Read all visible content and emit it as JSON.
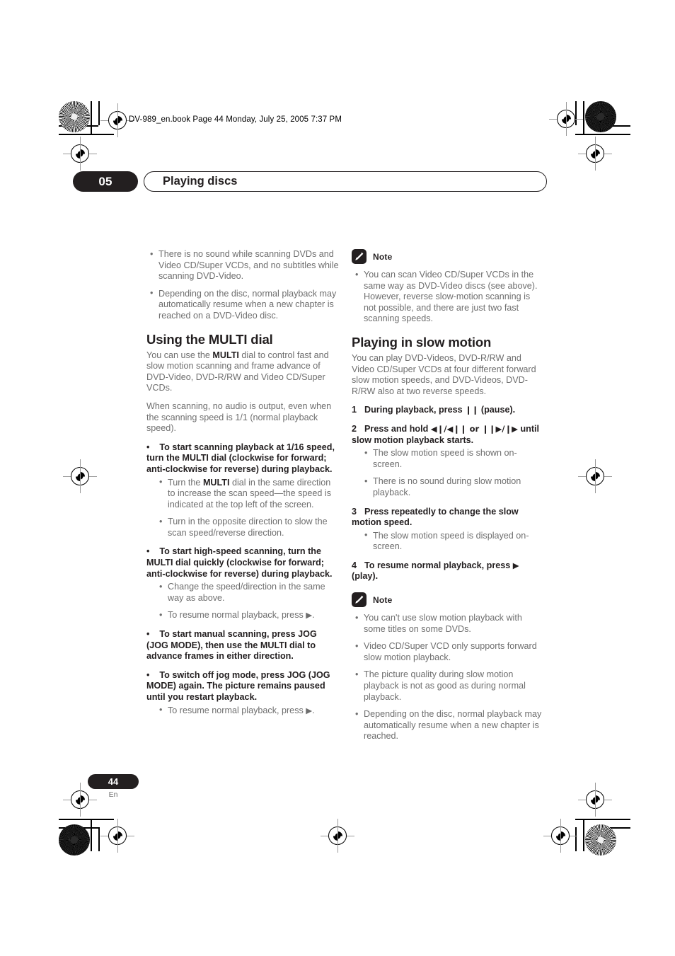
{
  "printmarks": {
    "file_header": "DV-989_en.book  Page 44  Monday, July 25, 2005  7:37 PM"
  },
  "running_head": {
    "chapter_number": "05",
    "chapter_title": "Playing discs"
  },
  "left_column": {
    "intro_bullets": [
      "There is no sound while scanning DVDs and Video CD/Super VCDs, and no subtitles while scanning DVD-Video.",
      "Depending on the disc, normal playback may automatically resume when a new chapter is reached on a DVD-Video disc."
    ],
    "section_heading": "Using the MULTI dial",
    "para_1_pre": "You can use the ",
    "para_1_bold": "MULTI",
    "para_1_post": " dial to control fast and slow motion scanning and frame advance of DVD-Video, DVD-R/RW and Video CD/Super VCDs.",
    "para_2": "When scanning, no audio is output, even when the scanning speed is 1/1 (normal playback speed).",
    "action_1": "To start scanning playback at 1/16 speed, turn the MULTI dial (clockwise for forward; anti-clockwise for reverse) during playback.",
    "action_1_subs": [
      {
        "pre": "Turn the ",
        "bold": "MULTI",
        "post": " dial in the same direction to increase the scan speed—the speed is indicated at the top left of the screen."
      },
      {
        "pre": "Turn in the opposite direction to slow the scan speed/reverse direction.",
        "bold": "",
        "post": ""
      }
    ],
    "action_2": "To start high-speed scanning, turn the MULTI dial quickly (clockwise for forward; anti-clockwise for reverse) during playback.",
    "action_2_subs": [
      {
        "pre": "Change the speed/direction in the same way as above.",
        "bold": "",
        "post": ""
      },
      {
        "pre": "To resume normal playback, press ",
        "bold": "",
        "post": "▶."
      }
    ],
    "action_3": "To start manual scanning, press JOG (JOG MODE), then use the MULTI dial to advance frames in either direction.",
    "action_4": "To switch off jog mode, press JOG (JOG MODE) again. The picture remains paused until you restart playback.",
    "action_4_subs": [
      {
        "pre": "To resume normal playback, press ",
        "bold": "",
        "post": "▶."
      }
    ],
    "bullet_glyph": "•"
  },
  "right_column": {
    "note_1": {
      "icon": "pencil-note-icon",
      "label": "Note",
      "bullets": [
        "You can scan Video CD/Super VCDs in the same way as DVD-Video discs (see above). However, reverse slow-motion scanning is not possible, and there are just two fast scanning speeds."
      ]
    },
    "section_heading": "Playing in slow motion",
    "para_1": "You can play DVD-Videos, DVD-R/RW and Video CD/Super VCDs at four different forward slow motion speeds, and DVD-Videos, DVD-R/RW also at two reverse speeds.",
    "steps": [
      {
        "num": "1",
        "text_pre": "During playback, press ",
        "symbol": "❙❙",
        "text_post": " (pause)."
      },
      {
        "num": "2",
        "text_pre": "Press and hold ",
        "symbol": "◀❙/◀❙❙ or ❙❙▶/❙▶",
        "text_post": " until slow motion playback starts."
      },
      {
        "num": "3",
        "text_pre": "Press repeatedly to change the slow motion speed.",
        "symbol": "",
        "text_post": ""
      },
      {
        "num": "4",
        "text_pre": "To resume normal playback, press ",
        "symbol": "▶",
        "text_post": " (play)."
      }
    ],
    "step2_subs": [
      "The slow motion speed is shown on-screen.",
      "There is no sound during slow motion playback."
    ],
    "step3_subs": [
      "The slow motion speed is displayed on-screen."
    ],
    "note_2": {
      "icon": "pencil-note-icon",
      "label": "Note",
      "bullets": [
        "You can't use slow motion playback with some titles on some DVDs.",
        "Video CD/Super VCD only supports forward slow motion playback.",
        "The picture quality during slow motion playback is not as good as during normal playback.",
        "Depending on the disc, normal playback may automatically resume when a new chapter is reached."
      ]
    }
  },
  "folio": {
    "page_number": "44",
    "language": "En"
  },
  "colors": {
    "ink": "#231f20",
    "body_gray": "#6e6e6e",
    "paper": "#ffffff"
  }
}
